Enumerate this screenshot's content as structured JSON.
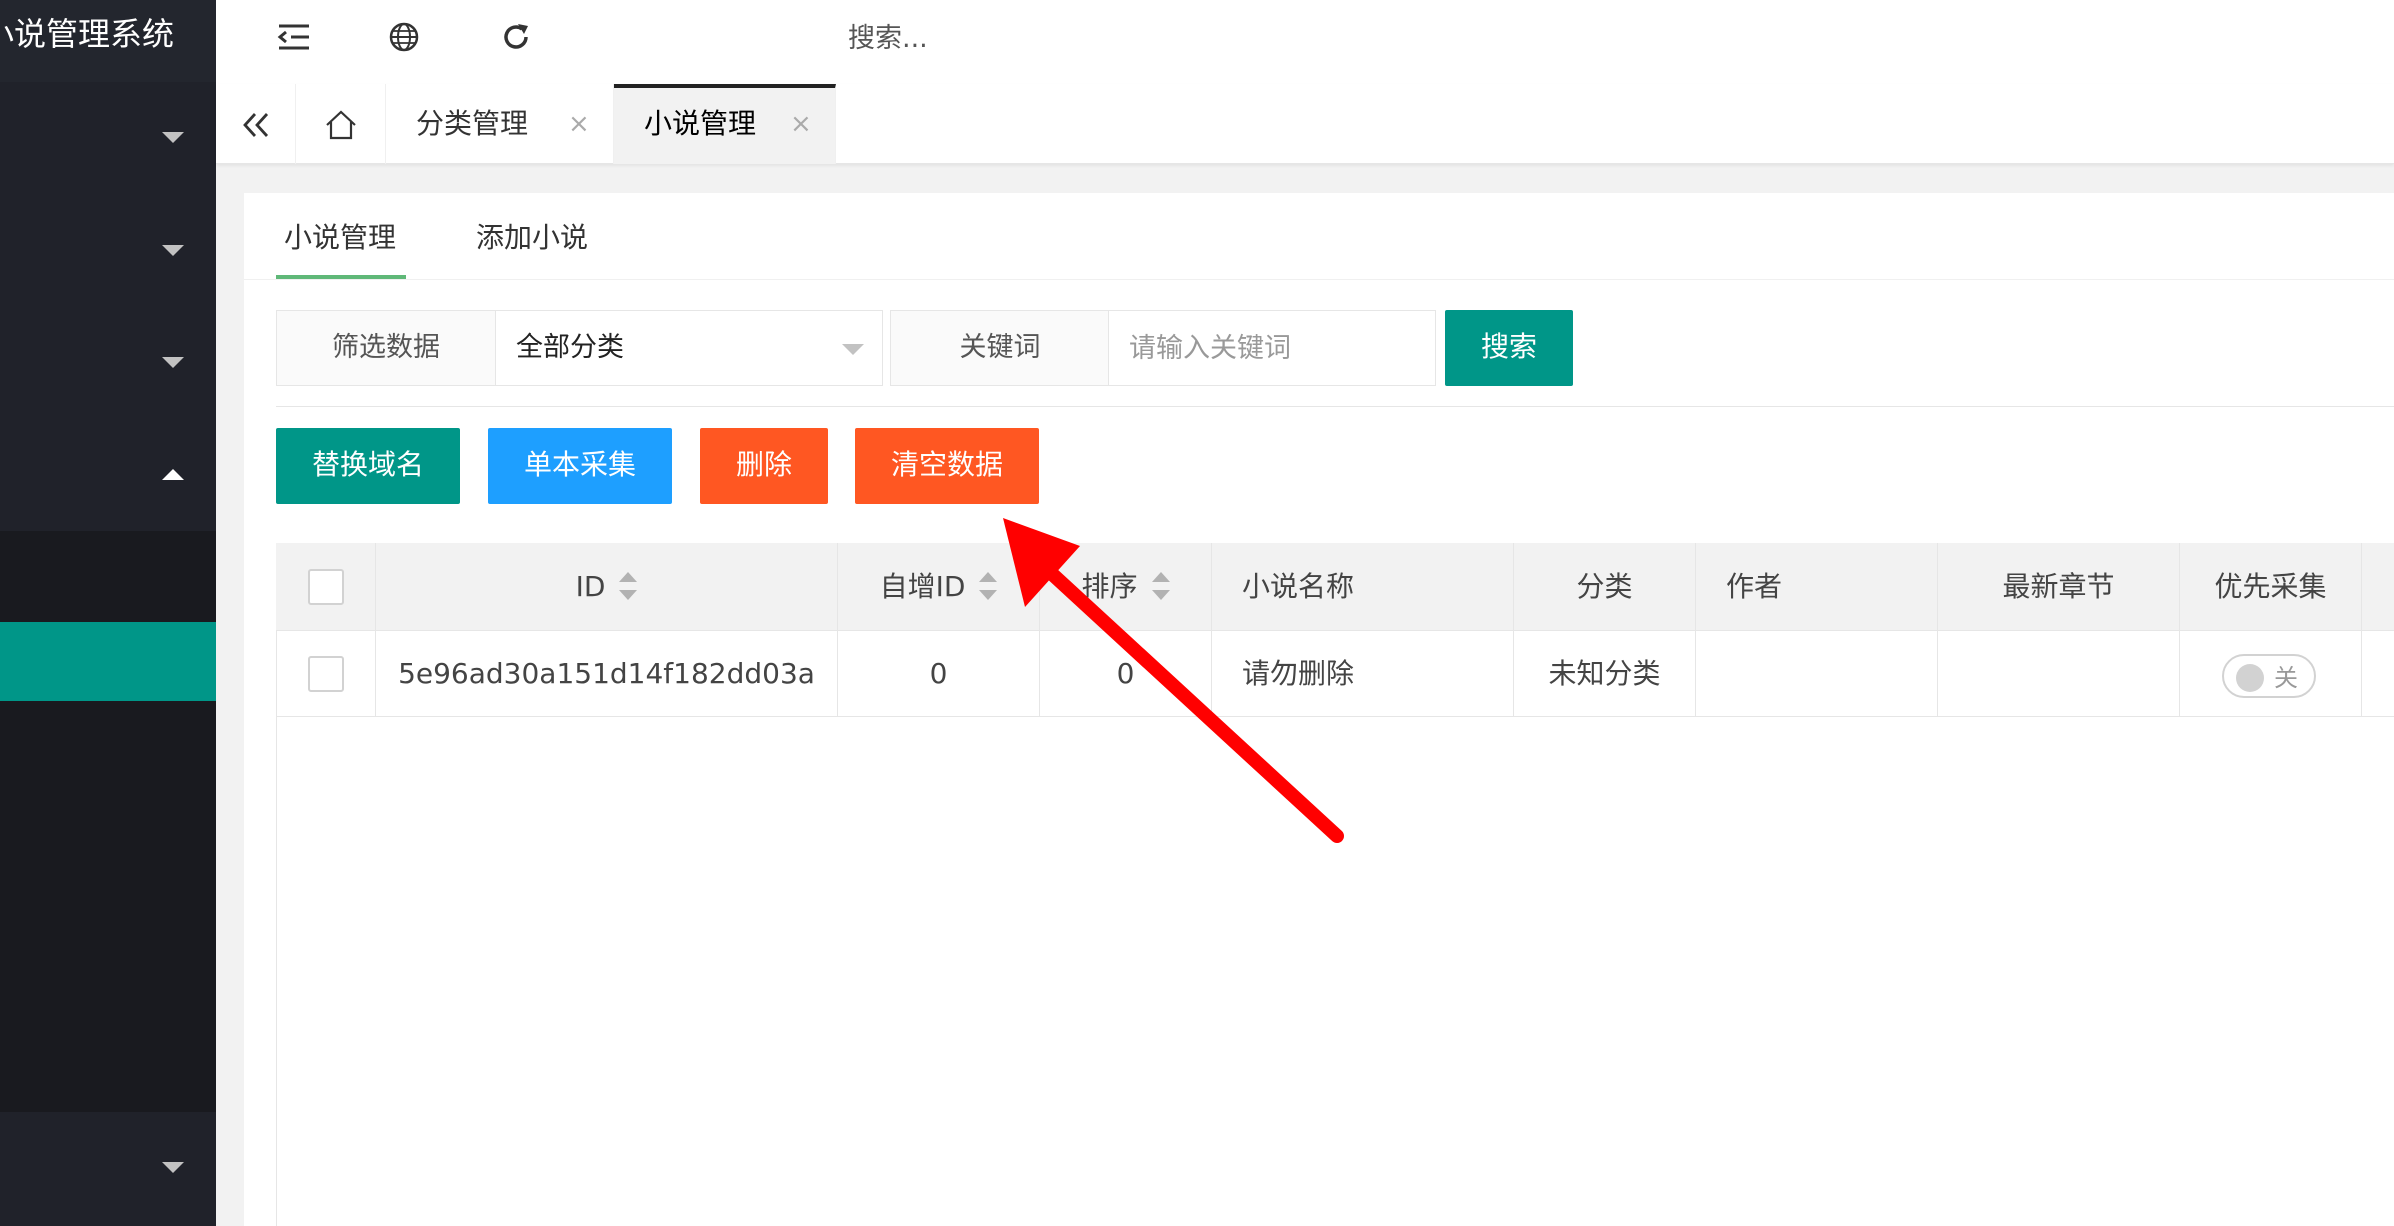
{
  "app": {
    "title": "小说管理系统"
  },
  "header": {
    "search_placeholder": "搜索..."
  },
  "tabs": [
    {
      "label": "分类管理",
      "close": "×"
    },
    {
      "label": "小说管理",
      "close": "×"
    }
  ],
  "subtabs": [
    "小说管理",
    "添加小说"
  ],
  "filter": {
    "label": "筛选数据",
    "selected": "全部分类",
    "keyword_label": "关键词",
    "keyword_placeholder": "请输入关键词",
    "search_button": "搜索"
  },
  "actions": {
    "replace_domain": "替换域名",
    "single_collect": "单本采集",
    "delete": "删除",
    "clear_data": "清空数据"
  },
  "table": {
    "columns": [
      "ID",
      "自增ID",
      "排序",
      "小说名称",
      "分类",
      "作者",
      "最新章节",
      "优先采集"
    ],
    "rows": [
      {
        "id": "5e96ad30a151d14f182dd03a",
        "auto_id": "0",
        "sort": "0",
        "name": "请勿删除",
        "category": "未知分类",
        "author": "",
        "latest_chapter": "",
        "priority_switch": "关"
      }
    ]
  },
  "colors": {
    "sidebar": "#20222a",
    "accent_teal": "#009688",
    "blue": "#1e9fff",
    "orange": "#ff5722",
    "arrow": "#ff0000"
  },
  "icons": [
    "menu-fold-icon",
    "globe-icon",
    "refresh-icon",
    "double-chevron-left-icon",
    "home-icon",
    "close-icon",
    "caret-down-icon",
    "caret-up-icon",
    "red-arrow-annotation"
  ]
}
